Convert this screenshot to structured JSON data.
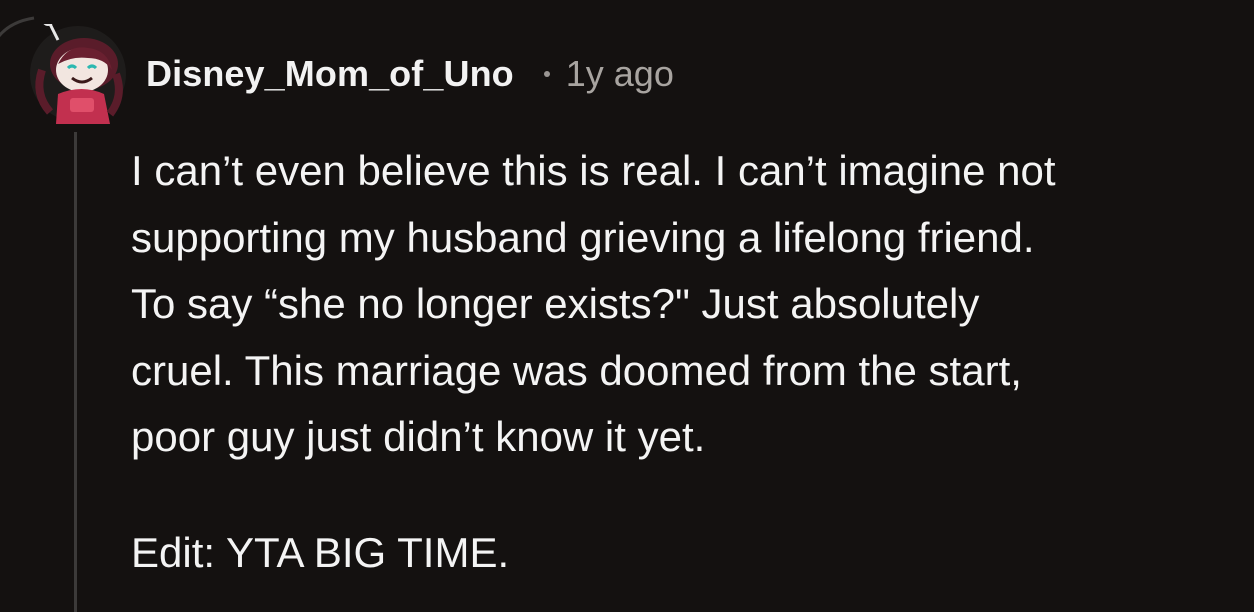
{
  "comment": {
    "author": "Disney_Mom_of_Uno",
    "separator": "•",
    "timestamp": "1y ago",
    "avatar_icon": "snoo-avatar-icon",
    "body_lines": [
      "I can’t even believe this is real. I can’t imagine not",
      "supporting my husband grieving a lifelong friend.",
      "To say “she no longer exists?\" Just absolutely",
      "cruel. This marriage was doomed from the start,",
      "poor guy just didn’t know it yet."
    ],
    "edit_line": "Edit: YTA BIG TIME."
  },
  "colors": {
    "background": "#141110",
    "text": "#f4f4f4",
    "meta_text": "#a8a4a0",
    "thread_line": "#3c3a39"
  }
}
